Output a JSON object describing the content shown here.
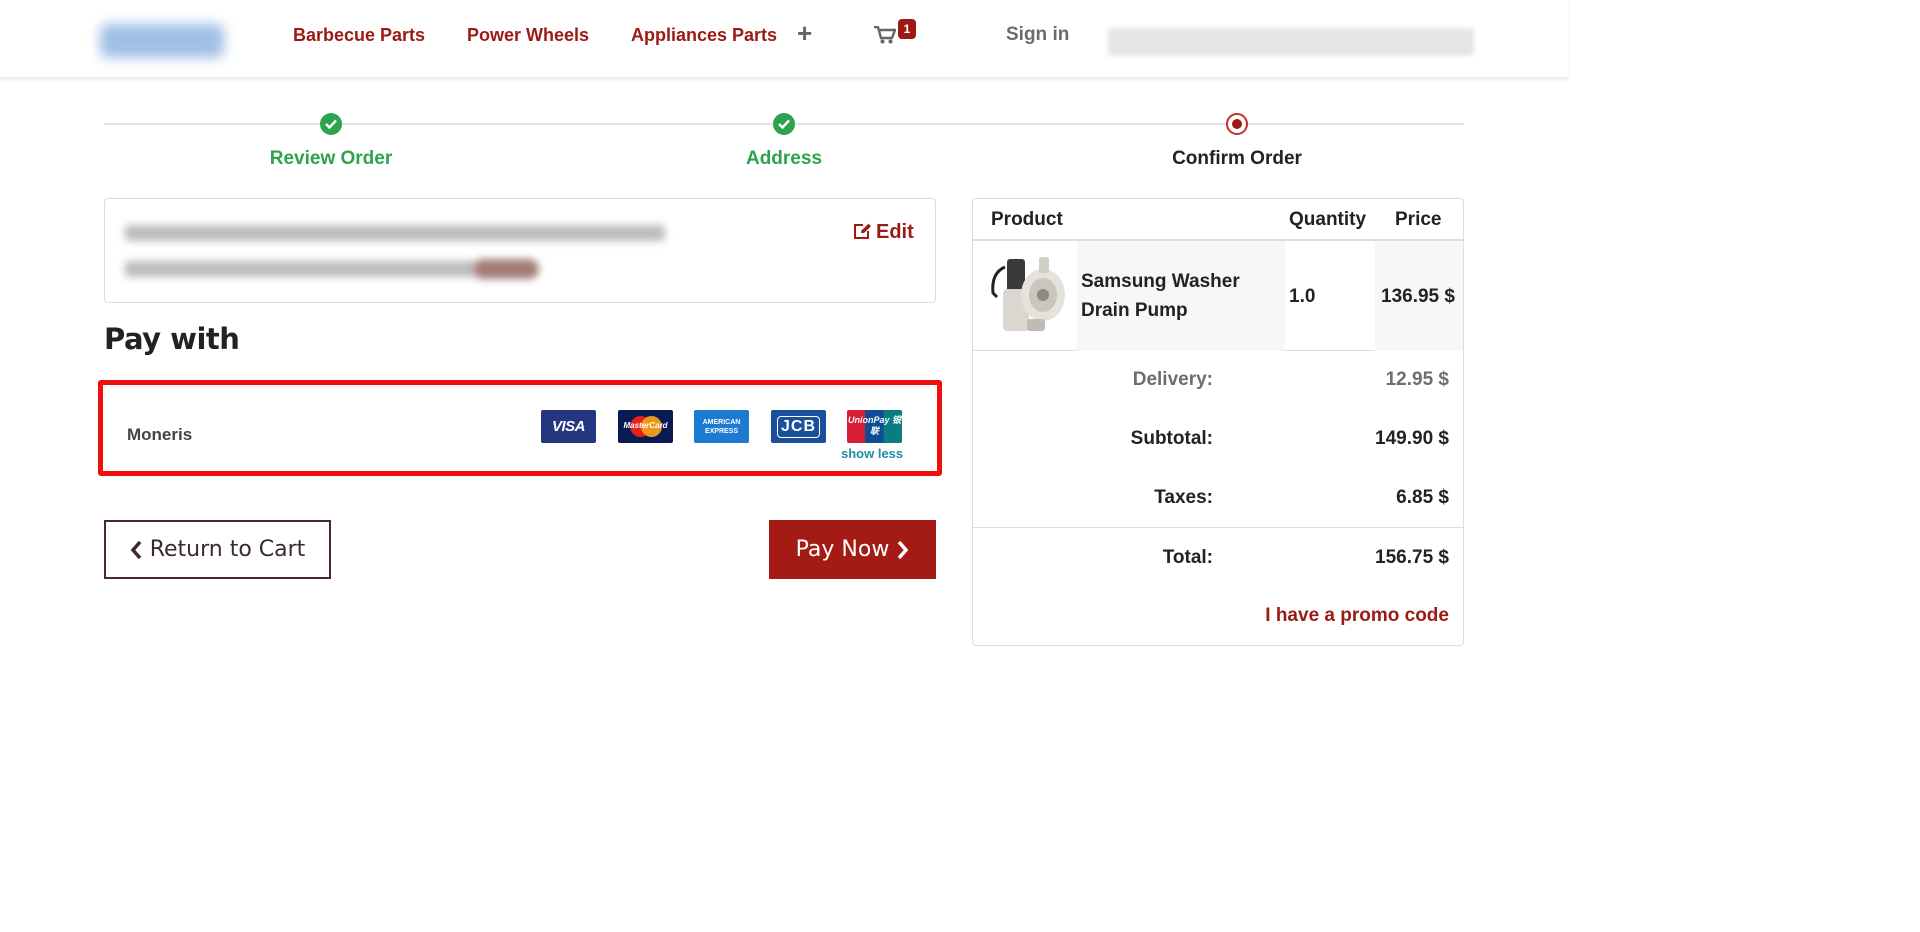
{
  "header": {
    "nav": [
      "Barbecue Parts",
      "Power Wheels",
      "Appliances Parts"
    ],
    "more_icon": "+",
    "cart_icon": "shopping-cart-icon",
    "cart_count": "1",
    "sign_in": "Sign in"
  },
  "steps": [
    {
      "label": "Review Order",
      "status": "done"
    },
    {
      "label": "Address",
      "status": "done"
    },
    {
      "label": "Confirm Order",
      "status": "current"
    }
  ],
  "address": {
    "edit_label": "Edit"
  },
  "payment": {
    "title": "Pay with",
    "provider": "Moneris",
    "cards": {
      "visa": "VISA",
      "mastercard": "MasterCard",
      "amex": "AMERICAN EXPRESS",
      "jcb": "JCB",
      "unionpay": "UnionPay 银联"
    },
    "toggle": "show less"
  },
  "actions": {
    "return": "Return to Cart",
    "pay": "Pay Now"
  },
  "summary": {
    "columns": {
      "product": "Product",
      "quantity": "Quantity",
      "price": "Price"
    },
    "item": {
      "name": "Samsung Washer Drain Pump",
      "quantity": "1.0",
      "price": "136.95 $"
    },
    "delivery": {
      "label": "Delivery:",
      "value": "12.95 $"
    },
    "subtotal": {
      "label": "Subtotal:",
      "value": "149.90 $"
    },
    "taxes": {
      "label": "Taxes:",
      "value": "6.85 $"
    },
    "total": {
      "label": "Total:",
      "value": "156.75 $"
    },
    "promo": "I have a promo code"
  },
  "colors": {
    "brand_red": "#9b1b14",
    "success_green": "#2da34d",
    "highlight_red": "#ef0e0e"
  }
}
